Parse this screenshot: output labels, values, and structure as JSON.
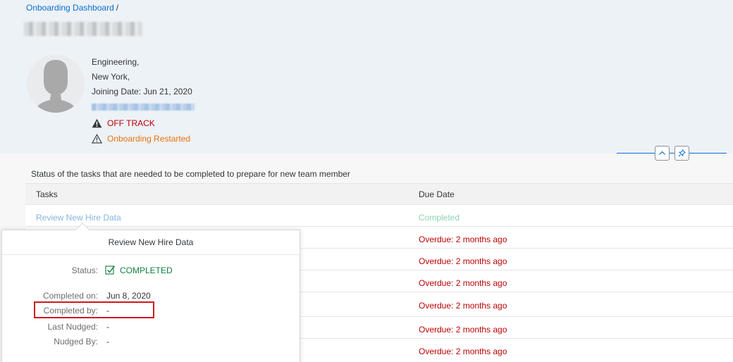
{
  "breadcrumb": {
    "root": "Onboarding Dashboard",
    "separator": "/"
  },
  "profile": {
    "department": "Engineering,",
    "location": "New York,",
    "joining_date": "Joining Date: Jun 21, 2020",
    "status": "OFF TRACK",
    "onboarding_state": "Onboarding Restarted"
  },
  "tasks_section": {
    "title": "Status of the tasks that are needed to be completed to prepare for new team member",
    "columns": [
      "Tasks",
      "Due Date"
    ],
    "rows": [
      {
        "task": "Review New Hire Data",
        "due": "Completed"
      },
      {
        "task": "",
        "due": "Overdue: 2 months ago"
      },
      {
        "task": "",
        "due": "Overdue: 2 months ago"
      },
      {
        "task": "",
        "due": "Overdue: 2 months ago"
      },
      {
        "task": "",
        "due": "Overdue: 2 months ago"
      },
      {
        "task": "",
        "due": "Overdue: 2 months ago"
      },
      {
        "task": "",
        "due": "Overdue: 2 months ago"
      }
    ]
  },
  "popover": {
    "title": "Review New Hire Data",
    "status_label": "Status:",
    "status_value": "COMPLETED",
    "completed_on_label": "Completed on:",
    "completed_on_value": "Jun 8, 2020",
    "completed_by_label": "Completed by:",
    "completed_by_value": "-",
    "last_nudged_label": "Last Nudged:",
    "last_nudged_value": "-",
    "nudged_by_label": "Nudged By:",
    "nudged_by_value": "-"
  },
  "colors": {
    "link": "#0a6ed1",
    "negative": "#bb0000",
    "warning": "#e9730c",
    "positive": "#107e3e",
    "highlight": "#d0181b"
  },
  "icons": {
    "off_track": "warning-filled-icon",
    "restarted": "warning-outline-icon",
    "collapse": "chevron-up-icon",
    "pin": "pin-icon",
    "status_completed": "checkbox-checked-icon"
  }
}
